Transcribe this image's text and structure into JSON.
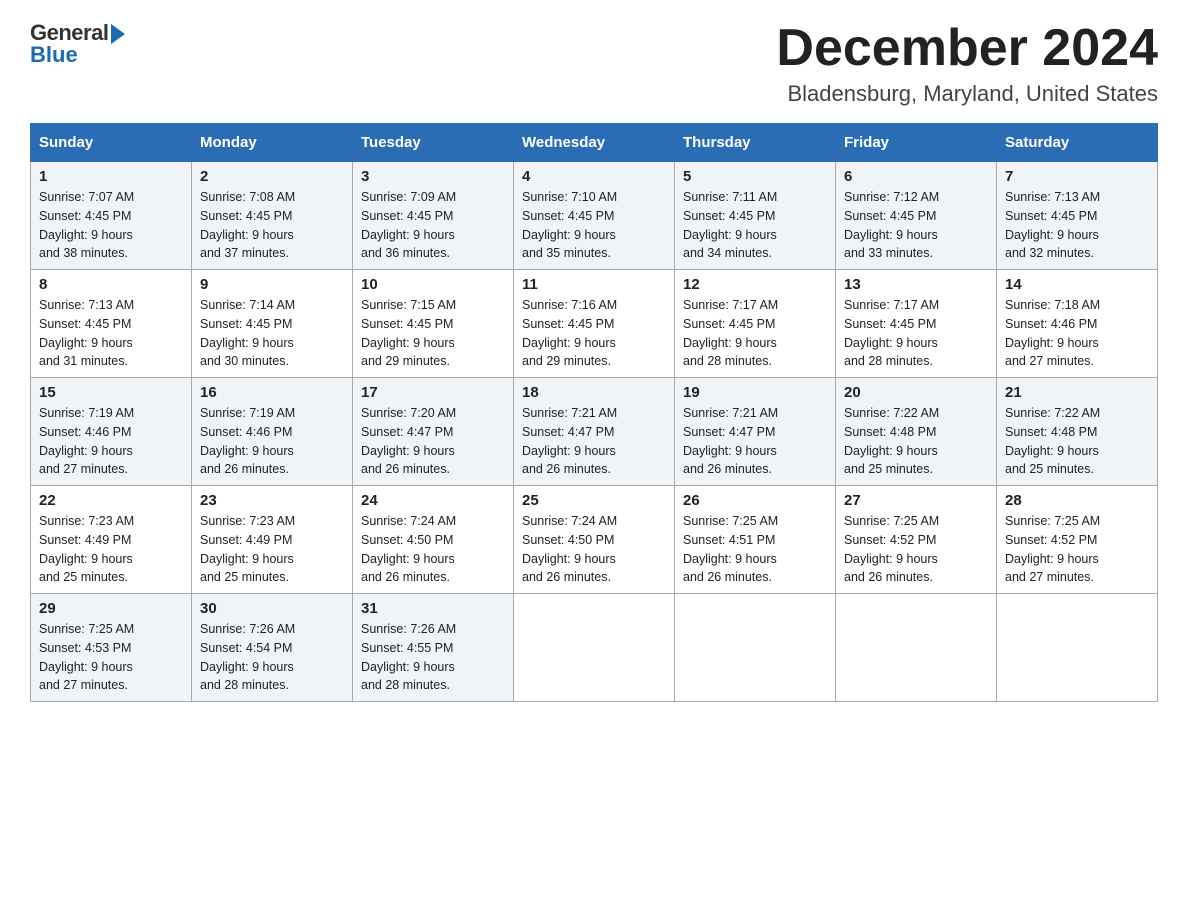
{
  "logo": {
    "general": "General",
    "blue": "Blue"
  },
  "title": "December 2024",
  "subtitle": "Bladensburg, Maryland, United States",
  "days_of_week": [
    "Sunday",
    "Monday",
    "Tuesday",
    "Wednesday",
    "Thursday",
    "Friday",
    "Saturday"
  ],
  "weeks": [
    [
      {
        "day": "1",
        "sunrise": "7:07 AM",
        "sunset": "4:45 PM",
        "daylight": "9 hours and 38 minutes."
      },
      {
        "day": "2",
        "sunrise": "7:08 AM",
        "sunset": "4:45 PM",
        "daylight": "9 hours and 37 minutes."
      },
      {
        "day": "3",
        "sunrise": "7:09 AM",
        "sunset": "4:45 PM",
        "daylight": "9 hours and 36 minutes."
      },
      {
        "day": "4",
        "sunrise": "7:10 AM",
        "sunset": "4:45 PM",
        "daylight": "9 hours and 35 minutes."
      },
      {
        "day": "5",
        "sunrise": "7:11 AM",
        "sunset": "4:45 PM",
        "daylight": "9 hours and 34 minutes."
      },
      {
        "day": "6",
        "sunrise": "7:12 AM",
        "sunset": "4:45 PM",
        "daylight": "9 hours and 33 minutes."
      },
      {
        "day": "7",
        "sunrise": "7:13 AM",
        "sunset": "4:45 PM",
        "daylight": "9 hours and 32 minutes."
      }
    ],
    [
      {
        "day": "8",
        "sunrise": "7:13 AM",
        "sunset": "4:45 PM",
        "daylight": "9 hours and 31 minutes."
      },
      {
        "day": "9",
        "sunrise": "7:14 AM",
        "sunset": "4:45 PM",
        "daylight": "9 hours and 30 minutes."
      },
      {
        "day": "10",
        "sunrise": "7:15 AM",
        "sunset": "4:45 PM",
        "daylight": "9 hours and 29 minutes."
      },
      {
        "day": "11",
        "sunrise": "7:16 AM",
        "sunset": "4:45 PM",
        "daylight": "9 hours and 29 minutes."
      },
      {
        "day": "12",
        "sunrise": "7:17 AM",
        "sunset": "4:45 PM",
        "daylight": "9 hours and 28 minutes."
      },
      {
        "day": "13",
        "sunrise": "7:17 AM",
        "sunset": "4:45 PM",
        "daylight": "9 hours and 28 minutes."
      },
      {
        "day": "14",
        "sunrise": "7:18 AM",
        "sunset": "4:46 PM",
        "daylight": "9 hours and 27 minutes."
      }
    ],
    [
      {
        "day": "15",
        "sunrise": "7:19 AM",
        "sunset": "4:46 PM",
        "daylight": "9 hours and 27 minutes."
      },
      {
        "day": "16",
        "sunrise": "7:19 AM",
        "sunset": "4:46 PM",
        "daylight": "9 hours and 26 minutes."
      },
      {
        "day": "17",
        "sunrise": "7:20 AM",
        "sunset": "4:47 PM",
        "daylight": "9 hours and 26 minutes."
      },
      {
        "day": "18",
        "sunrise": "7:21 AM",
        "sunset": "4:47 PM",
        "daylight": "9 hours and 26 minutes."
      },
      {
        "day": "19",
        "sunrise": "7:21 AM",
        "sunset": "4:47 PM",
        "daylight": "9 hours and 26 minutes."
      },
      {
        "day": "20",
        "sunrise": "7:22 AM",
        "sunset": "4:48 PM",
        "daylight": "9 hours and 25 minutes."
      },
      {
        "day": "21",
        "sunrise": "7:22 AM",
        "sunset": "4:48 PM",
        "daylight": "9 hours and 25 minutes."
      }
    ],
    [
      {
        "day": "22",
        "sunrise": "7:23 AM",
        "sunset": "4:49 PM",
        "daylight": "9 hours and 25 minutes."
      },
      {
        "day": "23",
        "sunrise": "7:23 AM",
        "sunset": "4:49 PM",
        "daylight": "9 hours and 25 minutes."
      },
      {
        "day": "24",
        "sunrise": "7:24 AM",
        "sunset": "4:50 PM",
        "daylight": "9 hours and 26 minutes."
      },
      {
        "day": "25",
        "sunrise": "7:24 AM",
        "sunset": "4:50 PM",
        "daylight": "9 hours and 26 minutes."
      },
      {
        "day": "26",
        "sunrise": "7:25 AM",
        "sunset": "4:51 PM",
        "daylight": "9 hours and 26 minutes."
      },
      {
        "day": "27",
        "sunrise": "7:25 AM",
        "sunset": "4:52 PM",
        "daylight": "9 hours and 26 minutes."
      },
      {
        "day": "28",
        "sunrise": "7:25 AM",
        "sunset": "4:52 PM",
        "daylight": "9 hours and 27 minutes."
      }
    ],
    [
      {
        "day": "29",
        "sunrise": "7:25 AM",
        "sunset": "4:53 PM",
        "daylight": "9 hours and 27 minutes."
      },
      {
        "day": "30",
        "sunrise": "7:26 AM",
        "sunset": "4:54 PM",
        "daylight": "9 hours and 28 minutes."
      },
      {
        "day": "31",
        "sunrise": "7:26 AM",
        "sunset": "4:55 PM",
        "daylight": "9 hours and 28 minutes."
      },
      null,
      null,
      null,
      null
    ]
  ]
}
